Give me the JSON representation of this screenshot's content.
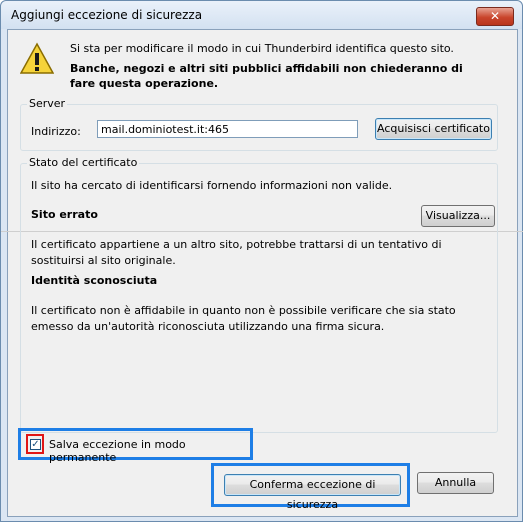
{
  "window": {
    "title": "Aggiungi eccezione di sicurezza",
    "close_glyph": "✕"
  },
  "warning": {
    "icon": "warning-icon",
    "line1": "Si sta per modificare il modo in cui Thunderbird identifica questo sito.",
    "line2": "Banche, negozi e altri siti pubblici affidabili non chiederanno di fare questa operazione."
  },
  "server": {
    "legend": "Server",
    "address_label": "Indirizzo:",
    "address_value": "mail.dominiotest.it:465",
    "fetch_button": "Acquisisci certificato"
  },
  "certificate": {
    "legend": "Stato del certificato",
    "intro": "Il sito ha cercato di identificarsi fornendo informazioni non valide.",
    "view_button": "Visualizza...",
    "sections": [
      {
        "heading": "Sito errato",
        "text": "Il certificato appartiene a un altro sito, potrebbe trattarsi di un tentativo di sostituirsi al sito originale."
      },
      {
        "heading": "Identità sconosciuta",
        "text": "Il certificato non è affidabile in quanto non è possibile verificare che sia stato emesso da un'autorità riconosciuta utilizzando una firma sicura."
      }
    ]
  },
  "permanent": {
    "label": "Salva eccezione in modo permanente",
    "checked": true,
    "check_glyph": "✓"
  },
  "buttons": {
    "confirm": "Conferma eccezione di sicurezza",
    "cancel": "Annulla"
  },
  "colors": {
    "highlight_blue": "#1e7ee6",
    "highlight_red": "#e01515"
  }
}
